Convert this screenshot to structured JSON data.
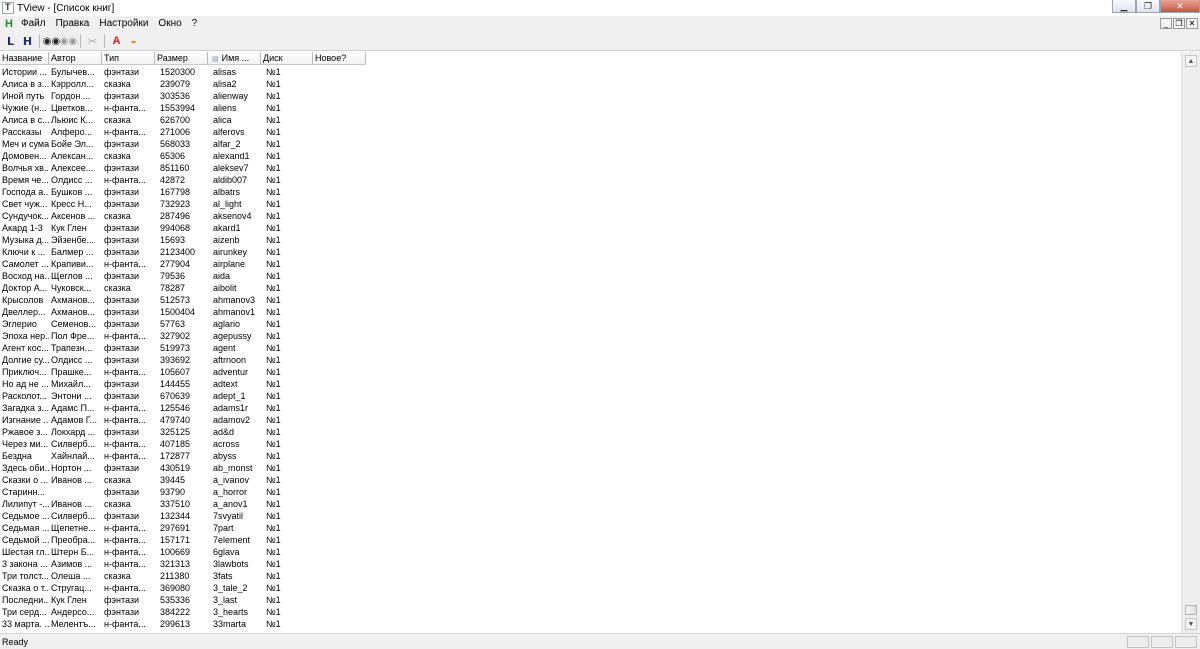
{
  "window": {
    "title": "TView - [Список книг]"
  },
  "menu": {
    "items": [
      "Файл",
      "Правка",
      "Настройки",
      "Окно",
      "?"
    ]
  },
  "toolbar": {
    "l_label": "L",
    "h_label": "H"
  },
  "table": {
    "columns": [
      "Название",
      "Автор",
      "Тип",
      "Размер",
      "Имя ...",
      "Диск",
      "Новое?"
    ],
    "sorted_column": 4,
    "rows": [
      [
        "Истории ...",
        "Булычев...",
        "фэнтази",
        "1520300",
        "alisas",
        "№1"
      ],
      [
        "Алиса в з...",
        "Кэрролл...",
        "сказка",
        "239079",
        "alisa2",
        "№1"
      ],
      [
        "Иной путь",
        "Гордон ...",
        "фэнтази",
        "303536",
        "alienway",
        "№1"
      ],
      [
        "Чужие (н...",
        "Цветков...",
        "н-фанта...",
        "1553994",
        "aliens",
        "№1"
      ],
      [
        "Алиса в с...",
        "Льюис К...",
        "сказка",
        "626700",
        "alica",
        "№1"
      ],
      [
        "Рассказы",
        "Алферо...",
        "н-фанта...",
        "271006",
        "alferovs",
        "№1"
      ],
      [
        "Меч и сума",
        "Бойе Эл...",
        "фэнтази",
        "568033",
        "alfar_2",
        "№1"
      ],
      [
        "Домовен...",
        "Алексан...",
        "сказка",
        "65306",
        "alexand1",
        "№1"
      ],
      [
        "Волчья хв...",
        "Алексее...",
        "фэнтази",
        "851160",
        "aleksev7",
        "№1"
      ],
      [
        "Время че...",
        "Олдисс ...",
        "н-фанта...",
        "42872",
        "aldib007",
        "№1"
      ],
      [
        "Господа а...",
        "Бушков ...",
        "фэнтази",
        "167798",
        "albatrs",
        "№1"
      ],
      [
        "Свет чуж...",
        "Кресс Н...",
        "фэнтази",
        "732923",
        "al_light",
        "№1"
      ],
      [
        "Сундучок...",
        "Аксенов ...",
        "сказка",
        "287496",
        "aksenov4",
        "№1"
      ],
      [
        "Акард 1-3",
        "Кук Глен",
        "фэнтази",
        "994068",
        "akard1",
        "№1"
      ],
      [
        "Музыка д...",
        "Эйзенбе...",
        "фэнтази",
        "15693",
        "aizenb",
        "№1"
      ],
      [
        "Ключи к ...",
        "Балмер ...",
        "фэнтази",
        "2123400",
        "airunkey",
        "№1"
      ],
      [
        "Самолет ...",
        "Крапиви...",
        "н-фанта...",
        "277904",
        "airplane",
        "№1"
      ],
      [
        "Восход на...",
        "Щеглов ...",
        "фэнтази",
        "79536",
        "aida",
        "№1"
      ],
      [
        "Доктор А...",
        "Чуковск...",
        "сказка",
        "78287",
        "aibolit",
        "№1"
      ],
      [
        "Крысолов",
        "Ахманов...",
        "фэнтази",
        "512573",
        "ahmanov3",
        "№1"
      ],
      [
        "Двеллер...",
        "Ахманов...",
        "фэнтази",
        "1500404",
        "ahmanov1",
        "№1"
      ],
      [
        "Эглерио",
        "Семенов...",
        "фэнтази",
        "57763",
        "aglario",
        "№1"
      ],
      [
        "Эпоха нер...",
        "Пол Фре...",
        "н-фанта...",
        "327902",
        "agepussy",
        "№1"
      ],
      [
        "Агент кос...",
        "Трапезн...",
        "фэнтази",
        "519973",
        "agent",
        "№1"
      ],
      [
        "Долгие су...",
        "Олдисс ...",
        "фэнтази",
        "393692",
        "aftrnoon",
        "№1"
      ],
      [
        "Приключ...",
        "Прашке...",
        "н-фанта...",
        "105607",
        "adventur",
        "№1"
      ],
      [
        "Но ад не ...",
        "Михайл...",
        "фэнтази",
        "144455",
        "adtext",
        "№1"
      ],
      [
        "Расколот...",
        "Энтони ...",
        "фэнтази",
        "670639",
        "adept_1",
        "№1"
      ],
      [
        "Загадка з...",
        "Адамс П...",
        "н-фанта...",
        "125546",
        "adams1r",
        "№1"
      ],
      [
        "Изгнание ...",
        "Адамов Г...",
        "н-фанта...",
        "479740",
        "adamov2",
        "№1"
      ],
      [
        "Ржавое з...",
        "Локхард ...",
        "фэнтази",
        "325125",
        "ad&d",
        "№1"
      ],
      [
        "Через ми...",
        "Силверб...",
        "н-фанта...",
        "407185",
        "across",
        "№1"
      ],
      [
        "Бездна",
        "Хайнлай...",
        "н-фанта...",
        "172877",
        "abyss",
        "№1"
      ],
      [
        "Здесь оби...",
        "Нортон ...",
        "фэнтази",
        "430519",
        "ab_monst",
        "№1"
      ],
      [
        "Сказки о ...",
        "Иванов ...",
        "сказка",
        "39445",
        "a_ivanov",
        "№1"
      ],
      [
        "Старинн...",
        "",
        "фэнтази",
        "93790",
        "a_horror",
        "№1"
      ],
      [
        "Лилипут -...",
        "Иванов ...",
        "сказка",
        "337510",
        "a_anov1",
        "№1"
      ],
      [
        "Седьмое ...",
        "Силверб...",
        "фэнтази",
        "132344",
        "7svyatil",
        "№1"
      ],
      [
        "Седьмая ...",
        "Щепетне...",
        "н-фанта...",
        "297691",
        "7part",
        "№1"
      ],
      [
        "Седьмой ...",
        "Преобра...",
        "н-фанта...",
        "157171",
        "7element",
        "№1"
      ],
      [
        "Шестая гл...",
        "Штерн Б...",
        "н-фанта...",
        "100669",
        "6glava",
        "№1"
      ],
      [
        "3 закона ...",
        "Азимов ...",
        "н-фанта...",
        "321313",
        "3lawbots",
        "№1"
      ],
      [
        "Три толст...",
        "Олеша ...",
        "сказка",
        "211380",
        "3fats",
        "№1"
      ],
      [
        "Сказка о т...",
        "Стругац...",
        "н-фанта...",
        "369080",
        "3_tale_2",
        "№1"
      ],
      [
        "Последни...",
        "Кук Глен",
        "фэнтази",
        "535336",
        "3_last",
        "№1"
      ],
      [
        "Три серд...",
        "Андерсо...",
        "фэнтази",
        "384222",
        "3_hearts",
        "№1"
      ],
      [
        "33 марта. ...",
        "Мелентъ...",
        "н-фанта...",
        "299613",
        "33marta",
        "№1"
      ]
    ]
  },
  "status": {
    "text": "Ready"
  }
}
